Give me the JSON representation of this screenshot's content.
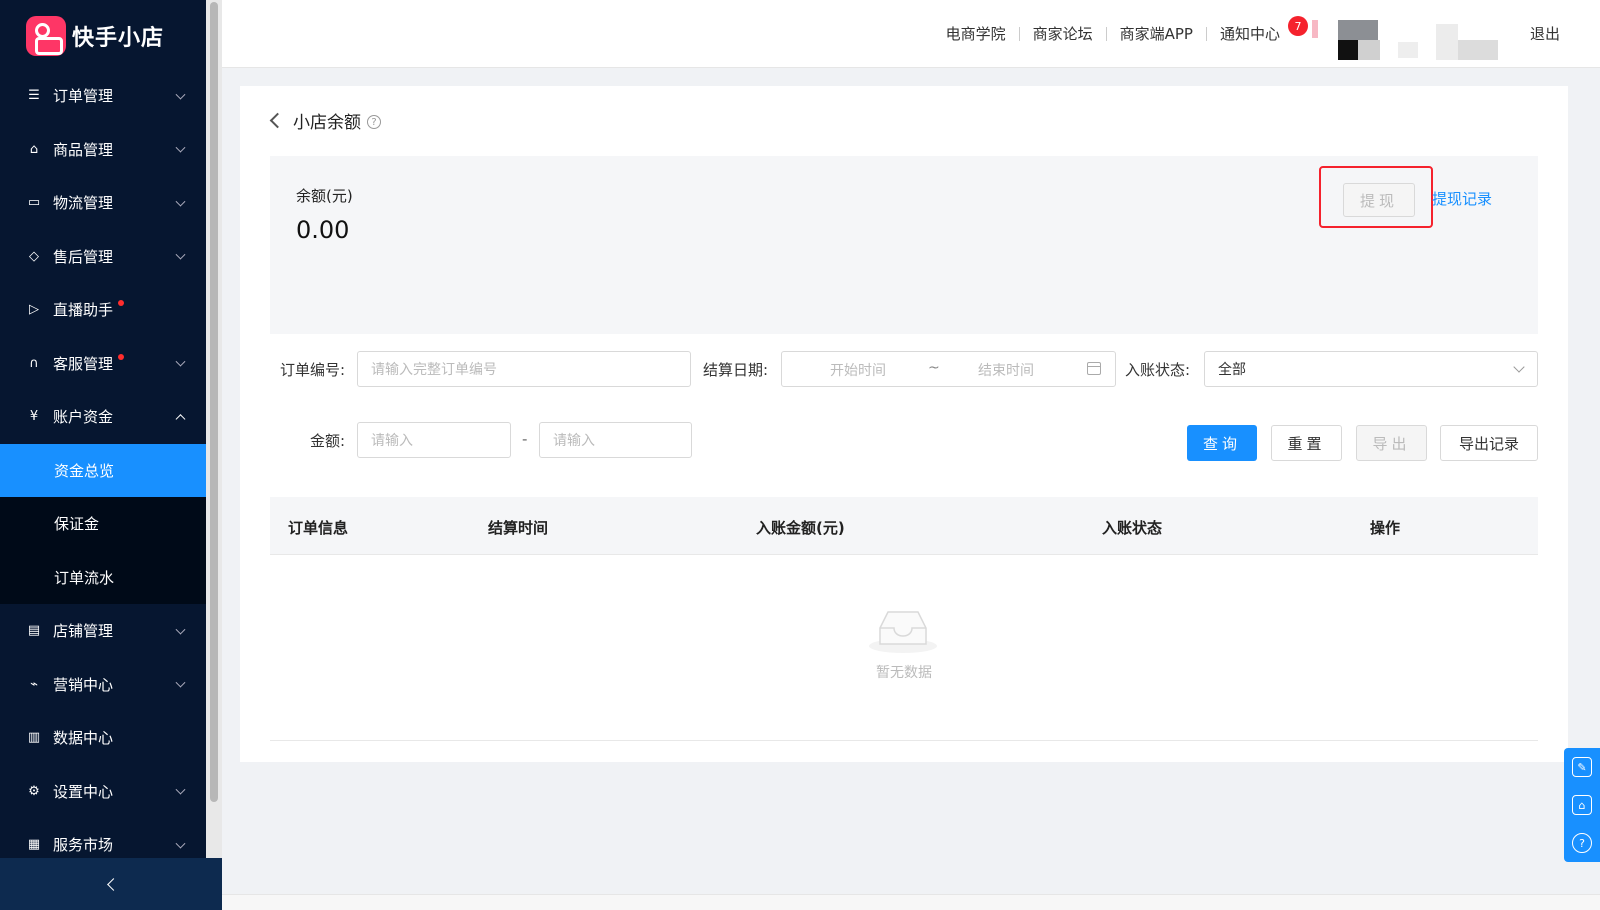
{
  "app": {
    "name": "快手小店"
  },
  "sidebar": {
    "items": [
      {
        "label": "订单管理",
        "icon": "list-icon",
        "expandable": true
      },
      {
        "label": "商品管理",
        "icon": "bag-icon",
        "expandable": true
      },
      {
        "label": "物流管理",
        "icon": "truck-icon",
        "expandable": true
      },
      {
        "label": "售后管理",
        "icon": "shield-icon",
        "expandable": true
      },
      {
        "label": "直播助手",
        "icon": "video-icon",
        "dot": true
      },
      {
        "label": "客服管理",
        "icon": "headset-icon",
        "expandable": true,
        "dot": true
      },
      {
        "label": "账户资金",
        "icon": "yen-icon",
        "expanded": true
      },
      {
        "label": "店铺管理",
        "icon": "store-icon",
        "expandable": true
      },
      {
        "label": "营销中心",
        "icon": "chart-icon",
        "expandable": true
      },
      {
        "label": "数据中心",
        "icon": "bar-icon"
      },
      {
        "label": "设置中心",
        "icon": "gear-icon",
        "expandable": true
      },
      {
        "label": "服务市场",
        "icon": "grid-icon",
        "expandable": true
      }
    ],
    "submenu": [
      {
        "label": "资金总览",
        "active": true
      },
      {
        "label": "保证金"
      },
      {
        "label": "订单流水"
      }
    ]
  },
  "header": {
    "links": [
      "电商学院",
      "商家论坛",
      "商家端APP",
      "通知中心"
    ],
    "notification_count": "7",
    "logout": "退出"
  },
  "page": {
    "title": "小店余额",
    "help": "?",
    "balance_label": "余额(元)",
    "balance_value": "0.00",
    "withdraw": "提现",
    "withdraw_record": "提现记录"
  },
  "filters": {
    "order_no_label": "订单编号:",
    "order_no_placeholder": "请输入完整订单编号",
    "date_label": "结算日期:",
    "start_placeholder": "开始时间",
    "tilde": "~",
    "end_placeholder": "结束时间",
    "status_label": "入账状态:",
    "status_value": "全部",
    "amount_label": "金额:",
    "amount_min_placeholder": "请输入",
    "dash": "-",
    "amount_max_placeholder": "请输入",
    "query": "查询",
    "reset": "重置",
    "export": "导出",
    "export_record": "导出记录"
  },
  "table": {
    "columns": [
      "订单信息",
      "结算时间",
      "入账金额(元)",
      "入账状态",
      "操作"
    ],
    "empty_text": "暂无数据"
  },
  "colors": {
    "primary": "#1890ff",
    "sidebar": "#061630",
    "highlight": "#f5222d"
  }
}
